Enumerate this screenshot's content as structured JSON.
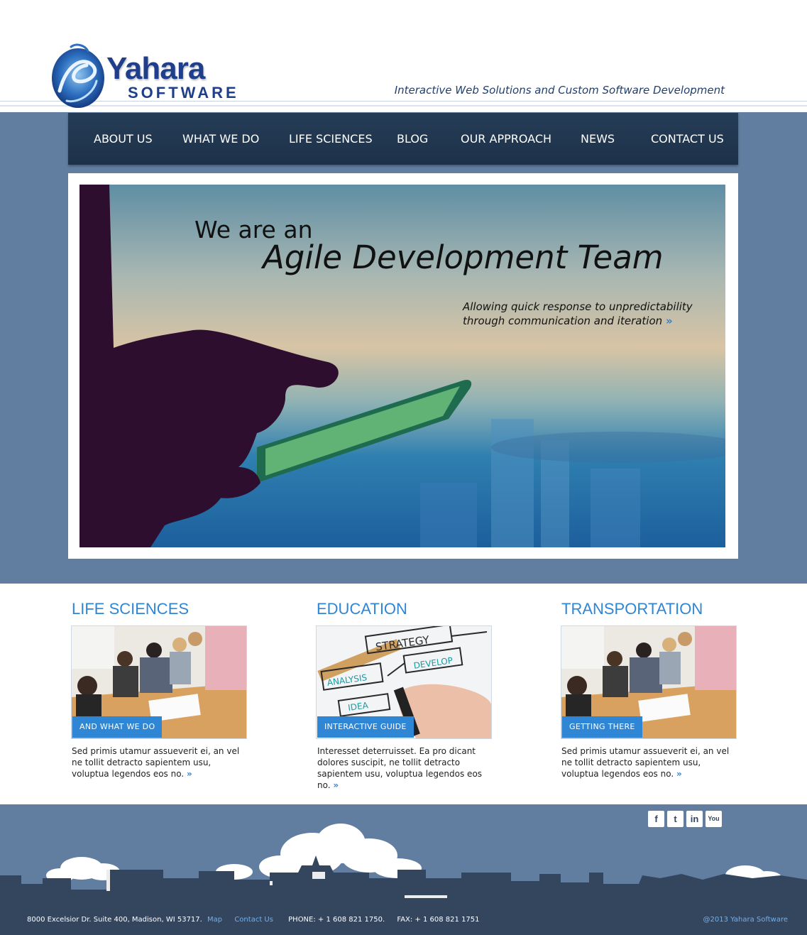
{
  "header": {
    "logo_name": "Yahara",
    "logo_sub": "SOFTWARE",
    "tagline": "Interactive Web Solutions and Custom Software Development"
  },
  "nav": {
    "items": [
      {
        "label": "ABOUT US"
      },
      {
        "label": "WHAT WE DO"
      },
      {
        "label": "LIFE SCIENCES"
      },
      {
        "label": "BLOG"
      },
      {
        "label": "OUR APPROACH"
      },
      {
        "label": "NEWS"
      },
      {
        "label": "CONTACT US"
      }
    ]
  },
  "hero": {
    "line1": "We are an",
    "line2": "Agile Development Team",
    "sub1": "Allowing quick response to unpredictability",
    "sub2": "through communication and iteration",
    "more": "»"
  },
  "cards": [
    {
      "title": "LIFE SCIENCES",
      "button": "AND WHAT WE DO",
      "text": "Sed primis utamur assueverit ei, an vel  ne tollit detracto sapientem usu, voluptua legendos eos no.",
      "more": "»"
    },
    {
      "title": "EDUCATION",
      "button": "INTERACTIVE GUIDE",
      "text": "Interesset deterruisset. Ea pro dicant dolores suscipit, ne tollit detracto sapientem usu, voluptua legendos eos no.",
      "more": "»"
    },
    {
      "title": "TRANSPORTATION",
      "button": "GETTING THERE",
      "text": "Sed primis utamur assueverit ei, an vel  ne tollit detracto sapientem usu, voluptua legendos eos no.",
      "more": "»"
    }
  ],
  "education_img_words": {
    "strategy": "STRATEGY",
    "develop": "DEVELOP",
    "analysis": "ANALYSIS",
    "idea": "IDEA"
  },
  "social": [
    {
      "icon": "facebook-icon",
      "glyph": "f"
    },
    {
      "icon": "twitter-icon",
      "glyph": "t"
    },
    {
      "icon": "linkedin-icon",
      "glyph": "in"
    },
    {
      "icon": "youtube-icon",
      "glyph": "You"
    }
  ],
  "footer": {
    "address": "8000 Excelsior Dr. Suite 400, Madison, WI 53717.",
    "map_link": "Map",
    "contact_link": "Contact Us",
    "phone": "PHONE:  + 1 608 821 1750.",
    "fax": "FAX:  + 1 608 821 1751",
    "copyright": "@2013 Yahara Software"
  },
  "colors": {
    "brand_blue": "#1f3f8c",
    "accent_blue": "#2f86d4",
    "band_blue": "#617ea0",
    "nav_dark": "#1d3149",
    "footer_dark": "#34465e"
  }
}
